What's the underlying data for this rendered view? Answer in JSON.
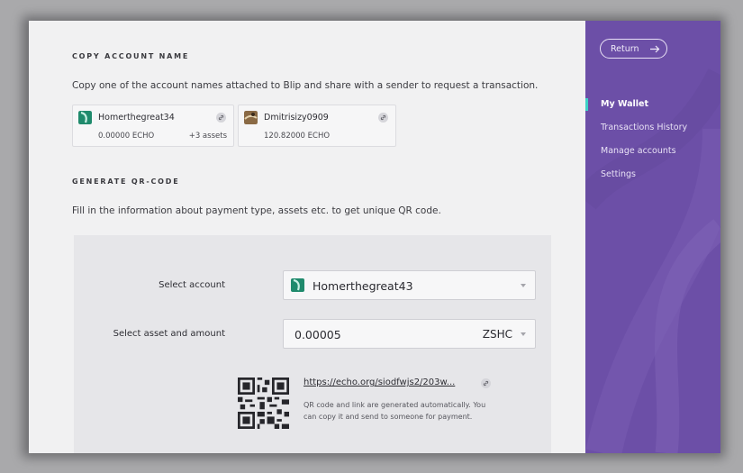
{
  "copy_section": {
    "title": "COPY ACCOUNT NAME",
    "description": "Copy one of the account names attached to Blip and share with a sender to request a transaction.",
    "accounts": [
      {
        "name": "Homerthegreat34",
        "balance": "0.00000 ECHO",
        "extra": "+3 assets"
      },
      {
        "name": "Dmitrisizy0909",
        "balance": "120.82000 ECHO",
        "extra": ""
      }
    ]
  },
  "qr_section": {
    "title": "GENERATE QR-CODE",
    "description": "Fill in the information about payment type, assets etc. to get unique QR code.",
    "select_account_label": "Select account",
    "selected_account": "Homerthegreat43",
    "select_asset_label": "Select asset and amount",
    "amount": "0.00005",
    "asset": "ZSHC",
    "link": "https://echo.org/siodfwjs2/203w...",
    "note_line1": "QR code and link are generated automatically. You",
    "note_line2": "can copy it and send to someone for payment."
  },
  "sidebar": {
    "return_label": "Return",
    "nav": [
      "My Wallet",
      "Transactions History",
      "Manage accounts",
      "Settings"
    ],
    "active": "My Wallet"
  },
  "colors": {
    "sidebar": "#6c4fa7",
    "active_indicator": "#3ed1c7",
    "avatar_green": "#1f8a6c"
  }
}
